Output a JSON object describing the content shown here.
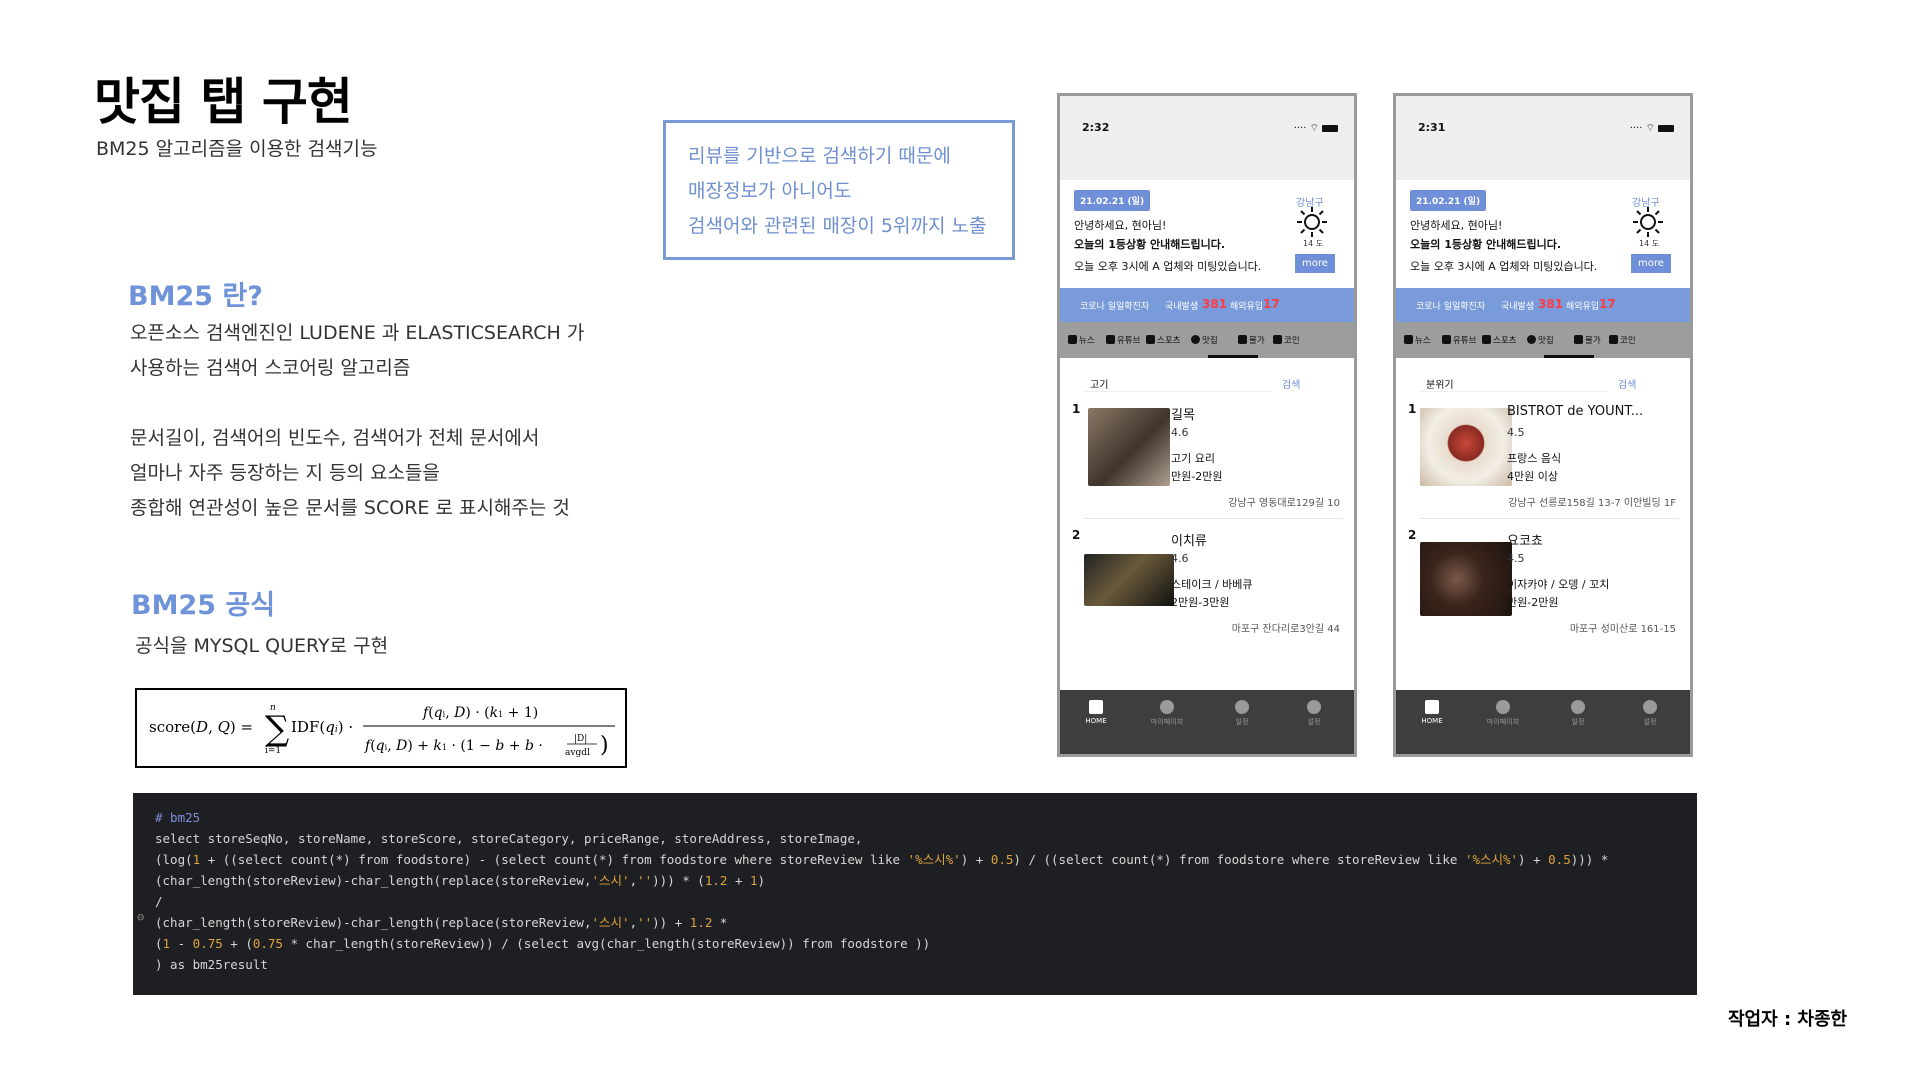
{
  "header": {
    "title": "맛집 탭 구현",
    "subtitle": "BM25 알고리즘을 이용한 검색기능"
  },
  "callout": {
    "lines": [
      "리뷰를 기반으로 검색하기 때문에",
      "매장정보가 아니어도",
      "검색어와 관련된 매장이 5위까지 노출"
    ]
  },
  "bm25_intro": {
    "heading": "BM25 란?",
    "lines": [
      "오픈소스 검색엔진인 LUDENE 과 ELASTICSEARCH 가",
      "사용하는 검색어 스코어링 알고리즘",
      "",
      "문서길이, 검색어의 빈도수, 검색어가 전체 문서에서",
      "얼마나 자주 등장하는 지 등의 요소들을",
      "종합해 연관성이 높은 문서를  SCORE 로 표시해주는 것"
    ]
  },
  "bm25_formula": {
    "heading": "BM25 공식",
    "description": "공식을 MYSQL QUERY로 구현"
  },
  "code": {
    "lines": [
      "# bm25",
      "select storeSeqNo, storeName, storeScore, storeCategory, priceRange, storeAddress, storeImage,",
      "(log(1 + ((select count(*) from foodstore) - (select count(*) from foodstore where storeReview like '%스시%') + 0.5) / ((select count(*) from foodstore where storeReview like '%스시%') + 0.5))) *",
      "(char_length(storeReview)-char_length(replace(storeReview,'스시',''))) * (1.2 + 1)",
      "/",
      "(char_length(storeReview)-char_length(replace(storeReview,'스시','')) + 1.2 *",
      "(1 - 0.75 + (0.75 * char_length(storeReview)) / (select avg(char_length(storeReview)) from foodstore ))",
      ") as bm25result"
    ]
  },
  "author": "작업자 : 차종한",
  "phones": [
    {
      "time": "2:32",
      "date": "21.02.21 (일)",
      "greeting": "안녕하세요, 현아님!",
      "guide": "오늘의 1등상황 안내해드립니다.",
      "meeting": "오늘 오후 3시에 A 업체와 미팅있습니다.",
      "more": "more",
      "location": "강남구",
      "temp": "14 도",
      "covid": {
        "label": "코로나 일일확진자",
        "domestic_label": "국내발생",
        "domestic": "381",
        "overseas_label": "해외유입",
        "overseas": "17"
      },
      "tabs": [
        "뉴스",
        "유튜브",
        "스포츠",
        "맛집",
        "물가",
        "코인"
      ],
      "search_value": "고기",
      "search_button": "검색",
      "results": [
        {
          "rank": "1",
          "name": "길목",
          "score": "4.6",
          "category": "고기 요리",
          "price": "만원-2만원",
          "address": "강남구 영동대로129길 10",
          "img_color": "#6b5a4a"
        },
        {
          "rank": "2",
          "name": "이치류",
          "score": "4.6",
          "category": "스테이크 / 바베큐",
          "price": "2만원-3만원",
          "address": "마포구 잔다리로3안길 44",
          "img_color": "#3a3226"
        }
      ],
      "nav": [
        "HOME",
        "마이페이지",
        "일정",
        "설정"
      ]
    },
    {
      "time": "2:31",
      "date": "21.02.21 (일)",
      "greeting": "안녕하세요, 현아님!",
      "guide": "오늘의 1등상황 안내해드립니다.",
      "meeting": "오늘 오후 3시에 A 업체와 미팅있습니다.",
      "more": "more",
      "location": "강남구",
      "temp": "14 도",
      "covid": {
        "label": "코로나 일일확진자",
        "domestic_label": "국내발생",
        "domestic": "381",
        "overseas_label": "해외유입",
        "overseas": "17"
      },
      "tabs": [
        "뉴스",
        "유튜브",
        "스포츠",
        "맛집",
        "물가",
        "코인"
      ],
      "search_value": "분위기",
      "search_button": "검색",
      "results": [
        {
          "rank": "1",
          "name": "BISTROT de YOUNT...",
          "score": "4.5",
          "category": "프랑스 음식",
          "price": "4만원 이상",
          "address": "강남구 선릉로158길 13-7 이안빌딩 1F",
          "img_color": "#b4483c"
        },
        {
          "rank": "2",
          "name": "요코쵸",
          "score": "4.5",
          "category": "이자카야 / 오뎅 / 꼬치",
          "price": "만원-2만원",
          "address": "마포구 성미산로 161-15",
          "img_color": "#4a3022"
        }
      ],
      "nav": [
        "HOME",
        "마이페이지",
        "일정",
        "설정"
      ]
    }
  ]
}
